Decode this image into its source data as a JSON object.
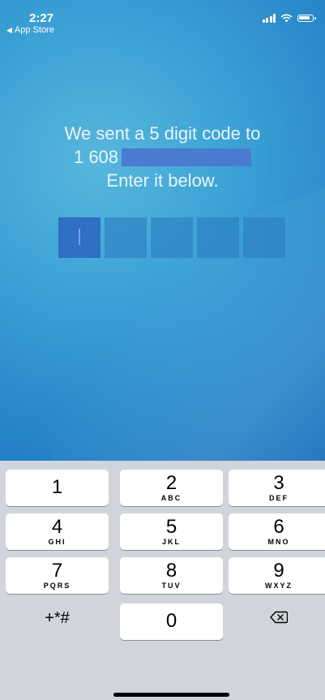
{
  "status_bar": {
    "time": "2:27",
    "back_label": "App Store"
  },
  "verification": {
    "line1": "We sent a 5 digit code to",
    "phone_prefix": "1 608",
    "line3": "Enter it below.",
    "code_length": 5
  },
  "keypad": {
    "keys": [
      {
        "digit": "1",
        "letters": ""
      },
      {
        "digit": "2",
        "letters": "ABC"
      },
      {
        "digit": "3",
        "letters": "DEF"
      },
      {
        "digit": "4",
        "letters": "GHI"
      },
      {
        "digit": "5",
        "letters": "JKL"
      },
      {
        "digit": "6",
        "letters": "MNO"
      },
      {
        "digit": "7",
        "letters": "PQRS"
      },
      {
        "digit": "8",
        "letters": "TUV"
      },
      {
        "digit": "9",
        "letters": "WXYZ"
      },
      {
        "digit": "0",
        "letters": ""
      }
    ],
    "symbols_label": "+*#",
    "backspace_icon": "delete-backward-icon"
  },
  "colors": {
    "accent": "#2f6fc4",
    "background_blue": "#3da3d6"
  }
}
